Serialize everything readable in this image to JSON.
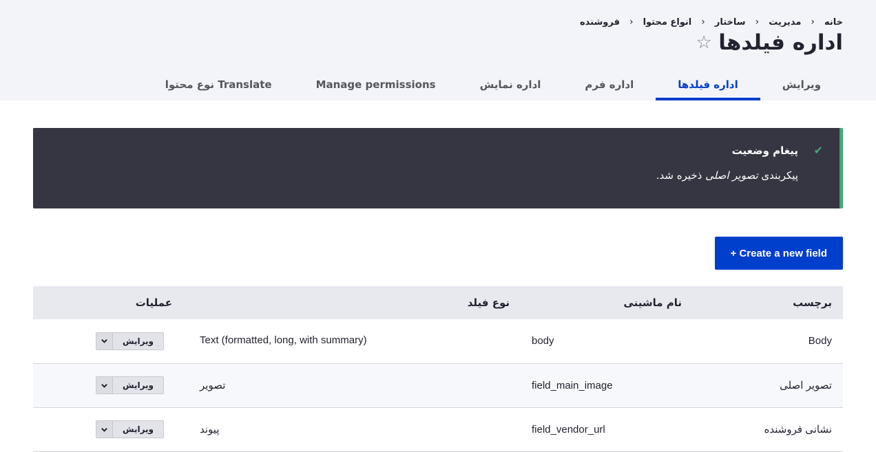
{
  "breadcrumb": [
    "خانه",
    "مدیریت",
    "ساختار",
    "انواع محتوا",
    "فروشنده"
  ],
  "page": {
    "title": "اداره فیلدها",
    "star": "☆"
  },
  "tabs": [
    {
      "label": "ویرایش",
      "active": false
    },
    {
      "label": "اداره فیلدها",
      "active": true
    },
    {
      "label": "اداره فرم",
      "active": false
    },
    {
      "label": "اداره نمایش",
      "active": false
    },
    {
      "label": "Manage permissions",
      "active": false
    },
    {
      "label": "Translate نوع محتوا",
      "active": false
    }
  ],
  "message": {
    "title": "پیغام وضعیت",
    "body_prefix": "پیکربندی",
    "body_em": "تصویر اصلی",
    "body_suffix": "ذخیره شد.",
    "icon": "check-icon",
    "accent": "#42a877"
  },
  "create_button": "+ Create a new field",
  "table": {
    "headers": {
      "label": "برچسب",
      "machine": "نام ماشینی",
      "type": "نوع فیلد",
      "ops": "عملیات"
    },
    "rows": [
      {
        "label": "Body",
        "machine": "body",
        "type": "Text (formatted, long, with summary)",
        "edit": "ویرایش"
      },
      {
        "label": "تصویر اصلی",
        "machine": "field_main_image",
        "type": "تصویر",
        "edit": "ویرایش"
      },
      {
        "label": "نشانی فروشنده",
        "machine": "field_vendor_url",
        "type": "پیوند",
        "edit": "ویرایش"
      }
    ]
  },
  "colors": {
    "primary": "#003ecc",
    "header_bg": "#f3f4f9",
    "message_bg": "#353641"
  }
}
